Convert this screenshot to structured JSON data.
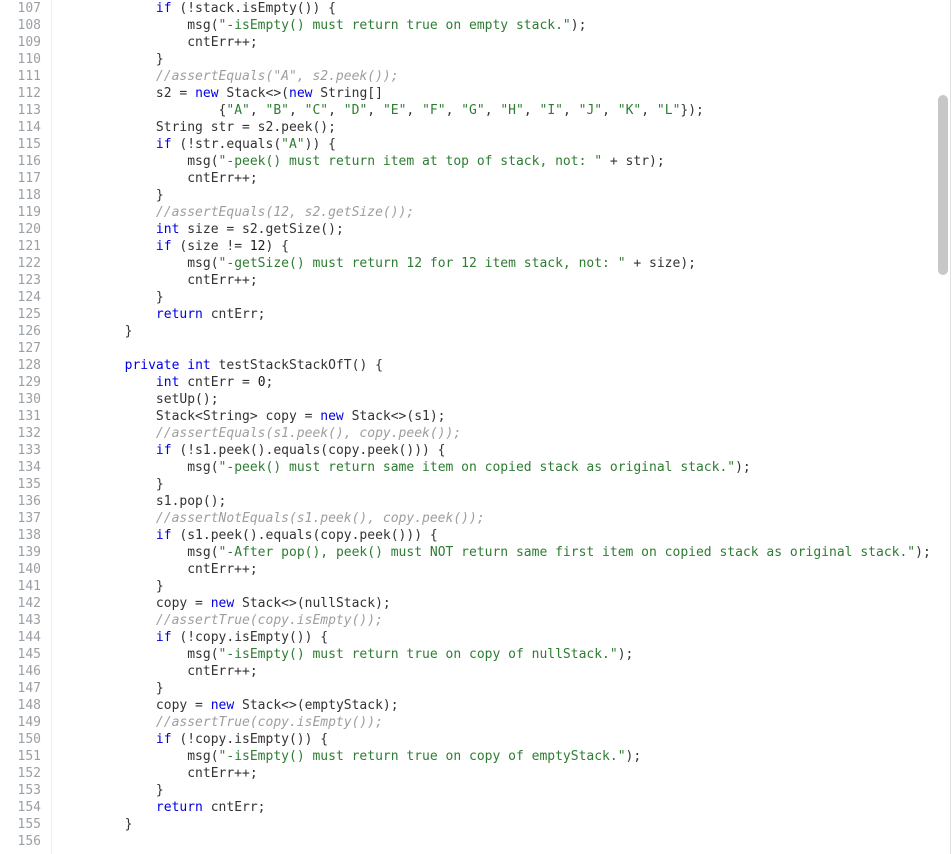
{
  "editor": {
    "first_line": 107,
    "lines": [
      {
        "tokens": [
          {
            "t": "            ",
            "c": ""
          },
          {
            "t": "if",
            "c": "kw"
          },
          {
            "t": " (!stack.isEmpty()) {",
            "c": ""
          }
        ]
      },
      {
        "tokens": [
          {
            "t": "                msg(",
            "c": ""
          },
          {
            "t": "\"-isEmpty() must return true on empty stack.\"",
            "c": "str"
          },
          {
            "t": ");",
            "c": ""
          }
        ]
      },
      {
        "tokens": [
          {
            "t": "                cntErr++;",
            "c": ""
          }
        ]
      },
      {
        "tokens": [
          {
            "t": "            }",
            "c": ""
          }
        ]
      },
      {
        "tokens": [
          {
            "t": "            ",
            "c": ""
          },
          {
            "t": "//assertEquals(\"A\", s2.peek());",
            "c": "cmt"
          }
        ]
      },
      {
        "tokens": [
          {
            "t": "            s2 = ",
            "c": ""
          },
          {
            "t": "new",
            "c": "kw"
          },
          {
            "t": " Stack<>(",
            "c": ""
          },
          {
            "t": "new",
            "c": "kw"
          },
          {
            "t": " String[]",
            "c": ""
          }
        ]
      },
      {
        "tokens": [
          {
            "t": "                    {",
            "c": ""
          },
          {
            "t": "\"A\"",
            "c": "str"
          },
          {
            "t": ", ",
            "c": ""
          },
          {
            "t": "\"B\"",
            "c": "str"
          },
          {
            "t": ", ",
            "c": ""
          },
          {
            "t": "\"C\"",
            "c": "str"
          },
          {
            "t": ", ",
            "c": ""
          },
          {
            "t": "\"D\"",
            "c": "str"
          },
          {
            "t": ", ",
            "c": ""
          },
          {
            "t": "\"E\"",
            "c": "str"
          },
          {
            "t": ", ",
            "c": ""
          },
          {
            "t": "\"F\"",
            "c": "str"
          },
          {
            "t": ", ",
            "c": ""
          },
          {
            "t": "\"G\"",
            "c": "str"
          },
          {
            "t": ", ",
            "c": ""
          },
          {
            "t": "\"H\"",
            "c": "str"
          },
          {
            "t": ", ",
            "c": ""
          },
          {
            "t": "\"I\"",
            "c": "str"
          },
          {
            "t": ", ",
            "c": ""
          },
          {
            "t": "\"J\"",
            "c": "str"
          },
          {
            "t": ", ",
            "c": ""
          },
          {
            "t": "\"K\"",
            "c": "str"
          },
          {
            "t": ", ",
            "c": ""
          },
          {
            "t": "\"L\"",
            "c": "str"
          },
          {
            "t": "});",
            "c": ""
          }
        ]
      },
      {
        "tokens": [
          {
            "t": "            String str = s2.peek();",
            "c": ""
          }
        ]
      },
      {
        "tokens": [
          {
            "t": "            ",
            "c": ""
          },
          {
            "t": "if",
            "c": "kw"
          },
          {
            "t": " (!str.equals(",
            "c": ""
          },
          {
            "t": "\"A\"",
            "c": "str"
          },
          {
            "t": ")) {",
            "c": ""
          }
        ]
      },
      {
        "tokens": [
          {
            "t": "                msg(",
            "c": ""
          },
          {
            "t": "\"-peek() must return item at top of stack, not: \"",
            "c": "str"
          },
          {
            "t": " + str);",
            "c": ""
          }
        ]
      },
      {
        "tokens": [
          {
            "t": "                cntErr++;",
            "c": ""
          }
        ]
      },
      {
        "tokens": [
          {
            "t": "            }",
            "c": ""
          }
        ]
      },
      {
        "tokens": [
          {
            "t": "            ",
            "c": ""
          },
          {
            "t": "//assertEquals(12, s2.getSize());",
            "c": "cmt"
          }
        ]
      },
      {
        "tokens": [
          {
            "t": "            ",
            "c": ""
          },
          {
            "t": "int",
            "c": "kw"
          },
          {
            "t": " size = s2.getSize();",
            "c": ""
          }
        ]
      },
      {
        "tokens": [
          {
            "t": "            ",
            "c": ""
          },
          {
            "t": "if",
            "c": "kw"
          },
          {
            "t": " (size != ",
            "c": ""
          },
          {
            "t": "12",
            "c": "num"
          },
          {
            "t": ") {",
            "c": ""
          }
        ]
      },
      {
        "tokens": [
          {
            "t": "                msg(",
            "c": ""
          },
          {
            "t": "\"-getSize() must return 12 for 12 item stack, not: \"",
            "c": "str"
          },
          {
            "t": " + size);",
            "c": ""
          }
        ]
      },
      {
        "tokens": [
          {
            "t": "                cntErr++;",
            "c": ""
          }
        ]
      },
      {
        "tokens": [
          {
            "t": "            }",
            "c": ""
          }
        ]
      },
      {
        "tokens": [
          {
            "t": "            ",
            "c": ""
          },
          {
            "t": "return",
            "c": "kw"
          },
          {
            "t": " cntErr;",
            "c": ""
          }
        ]
      },
      {
        "tokens": [
          {
            "t": "        }",
            "c": ""
          }
        ]
      },
      {
        "tokens": [
          {
            "t": "",
            "c": ""
          }
        ]
      },
      {
        "tokens": [
          {
            "t": "        ",
            "c": ""
          },
          {
            "t": "private",
            "c": "kw"
          },
          {
            "t": " ",
            "c": ""
          },
          {
            "t": "int",
            "c": "kw"
          },
          {
            "t": " testStackStackOfT() {",
            "c": ""
          }
        ]
      },
      {
        "tokens": [
          {
            "t": "            ",
            "c": ""
          },
          {
            "t": "int",
            "c": "kw"
          },
          {
            "t": " cntErr = ",
            "c": ""
          },
          {
            "t": "0",
            "c": "num"
          },
          {
            "t": ";",
            "c": ""
          }
        ]
      },
      {
        "tokens": [
          {
            "t": "            setUp();",
            "c": ""
          }
        ]
      },
      {
        "tokens": [
          {
            "t": "            Stack<String> copy = ",
            "c": ""
          },
          {
            "t": "new",
            "c": "kw"
          },
          {
            "t": " Stack<>(s1);",
            "c": ""
          }
        ]
      },
      {
        "tokens": [
          {
            "t": "            ",
            "c": ""
          },
          {
            "t": "//assertEquals(s1.peek(), copy.peek());",
            "c": "cmt"
          }
        ]
      },
      {
        "tokens": [
          {
            "t": "            ",
            "c": ""
          },
          {
            "t": "if",
            "c": "kw"
          },
          {
            "t": " (!s1.peek().equals(copy.peek())) {",
            "c": ""
          }
        ]
      },
      {
        "tokens": [
          {
            "t": "                msg(",
            "c": ""
          },
          {
            "t": "\"-peek() must return same item on copied stack as original stack.\"",
            "c": "str"
          },
          {
            "t": ");",
            "c": ""
          }
        ]
      },
      {
        "tokens": [
          {
            "t": "            }",
            "c": ""
          }
        ]
      },
      {
        "tokens": [
          {
            "t": "            s1.pop();",
            "c": ""
          }
        ]
      },
      {
        "tokens": [
          {
            "t": "            ",
            "c": ""
          },
          {
            "t": "//assertNotEquals(s1.peek(), copy.peek());",
            "c": "cmt"
          }
        ]
      },
      {
        "tokens": [
          {
            "t": "            ",
            "c": ""
          },
          {
            "t": "if",
            "c": "kw"
          },
          {
            "t": " (s1.peek().equals(copy.peek())) {",
            "c": ""
          }
        ]
      },
      {
        "tokens": [
          {
            "t": "                msg(",
            "c": ""
          },
          {
            "t": "\"-After pop(), peek() must NOT return same first item on copied stack as original stack.\"",
            "c": "str"
          },
          {
            "t": ");",
            "c": ""
          }
        ]
      },
      {
        "tokens": [
          {
            "t": "                cntErr++;",
            "c": ""
          }
        ]
      },
      {
        "tokens": [
          {
            "t": "            }",
            "c": ""
          }
        ]
      },
      {
        "tokens": [
          {
            "t": "            copy = ",
            "c": ""
          },
          {
            "t": "new",
            "c": "kw"
          },
          {
            "t": " Stack<>(nullStack);",
            "c": ""
          }
        ]
      },
      {
        "tokens": [
          {
            "t": "            ",
            "c": ""
          },
          {
            "t": "//assertTrue(copy.isEmpty());",
            "c": "cmt"
          }
        ]
      },
      {
        "tokens": [
          {
            "t": "            ",
            "c": ""
          },
          {
            "t": "if",
            "c": "kw"
          },
          {
            "t": " (!copy.isEmpty()) {",
            "c": ""
          }
        ]
      },
      {
        "tokens": [
          {
            "t": "                msg(",
            "c": ""
          },
          {
            "t": "\"-isEmpty() must return true on copy of nullStack.\"",
            "c": "str"
          },
          {
            "t": ");",
            "c": ""
          }
        ]
      },
      {
        "tokens": [
          {
            "t": "                cntErr++;",
            "c": ""
          }
        ]
      },
      {
        "tokens": [
          {
            "t": "            }",
            "c": ""
          }
        ]
      },
      {
        "tokens": [
          {
            "t": "            copy = ",
            "c": ""
          },
          {
            "t": "new",
            "c": "kw"
          },
          {
            "t": " Stack<>(emptyStack);",
            "c": ""
          }
        ]
      },
      {
        "tokens": [
          {
            "t": "            ",
            "c": ""
          },
          {
            "t": "//assertTrue(copy.isEmpty());",
            "c": "cmt"
          }
        ]
      },
      {
        "tokens": [
          {
            "t": "            ",
            "c": ""
          },
          {
            "t": "if",
            "c": "kw"
          },
          {
            "t": " (!copy.isEmpty()) {",
            "c": ""
          }
        ]
      },
      {
        "tokens": [
          {
            "t": "                msg(",
            "c": ""
          },
          {
            "t": "\"-isEmpty() must return true on copy of emptyStack.\"",
            "c": "str"
          },
          {
            "t": ");",
            "c": ""
          }
        ]
      },
      {
        "tokens": [
          {
            "t": "                cntErr++;",
            "c": ""
          }
        ]
      },
      {
        "tokens": [
          {
            "t": "            }",
            "c": ""
          }
        ]
      },
      {
        "tokens": [
          {
            "t": "            ",
            "c": ""
          },
          {
            "t": "return",
            "c": "kw"
          },
          {
            "t": " cntErr;",
            "c": ""
          }
        ]
      },
      {
        "tokens": [
          {
            "t": "        }",
            "c": ""
          }
        ]
      },
      {
        "tokens": [
          {
            "t": "",
            "c": ""
          }
        ]
      }
    ]
  }
}
